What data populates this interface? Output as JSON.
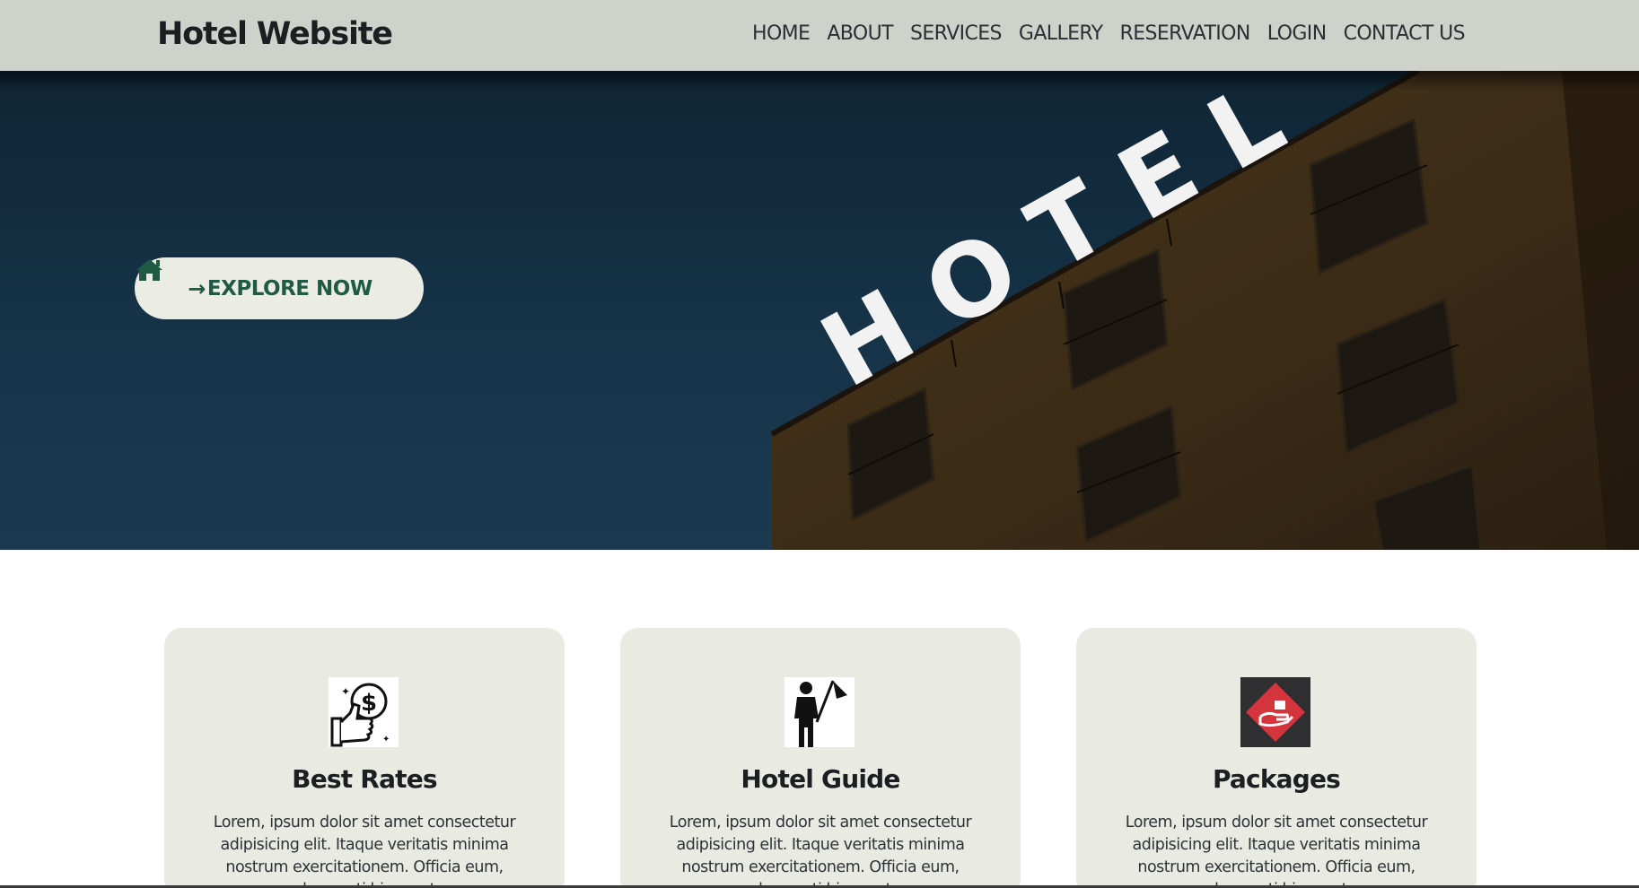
{
  "header": {
    "brand": "Hotel Website",
    "nav": [
      "HOME",
      "ABOUT",
      "SERVICES",
      "GALLERY",
      "RESERVATION",
      "LOGIN",
      "CONTACT US"
    ]
  },
  "hero": {
    "sign_text": "HOTEL",
    "explore_label": "EXPLORE NOW",
    "arrow": "→"
  },
  "cards": [
    {
      "title": "Best Rates",
      "icon": "thumbs-up-dollar-icon",
      "text": "Lorem, ipsum dolor sit amet consectetur adipisicing elit. Itaque veritatis minima nostrum exercitationem. Officia eum, obcaecati hic amet"
    },
    {
      "title": "Hotel Guide",
      "icon": "guide-with-flag-icon",
      "text": "Lorem, ipsum dolor sit amet consectetur adipisicing elit. Itaque veritatis minima nostrum exercitationem. Officia eum, obcaecati hic amet"
    },
    {
      "title": "Packages",
      "icon": "package-hand-icon",
      "text": "Lorem, ipsum dolor sit amet consectetur adipisicing elit. Itaque veritatis minima nostrum exercitationem. Officia eum, obcaecati hic amet"
    }
  ],
  "colors": {
    "nav_bg": "#cfd2cb",
    "sky": "#163348",
    "building": "#3a2a16",
    "button_text": "#1f5a44",
    "card_bg": "#e9eae2",
    "package_icon_red": "#d6343c"
  }
}
